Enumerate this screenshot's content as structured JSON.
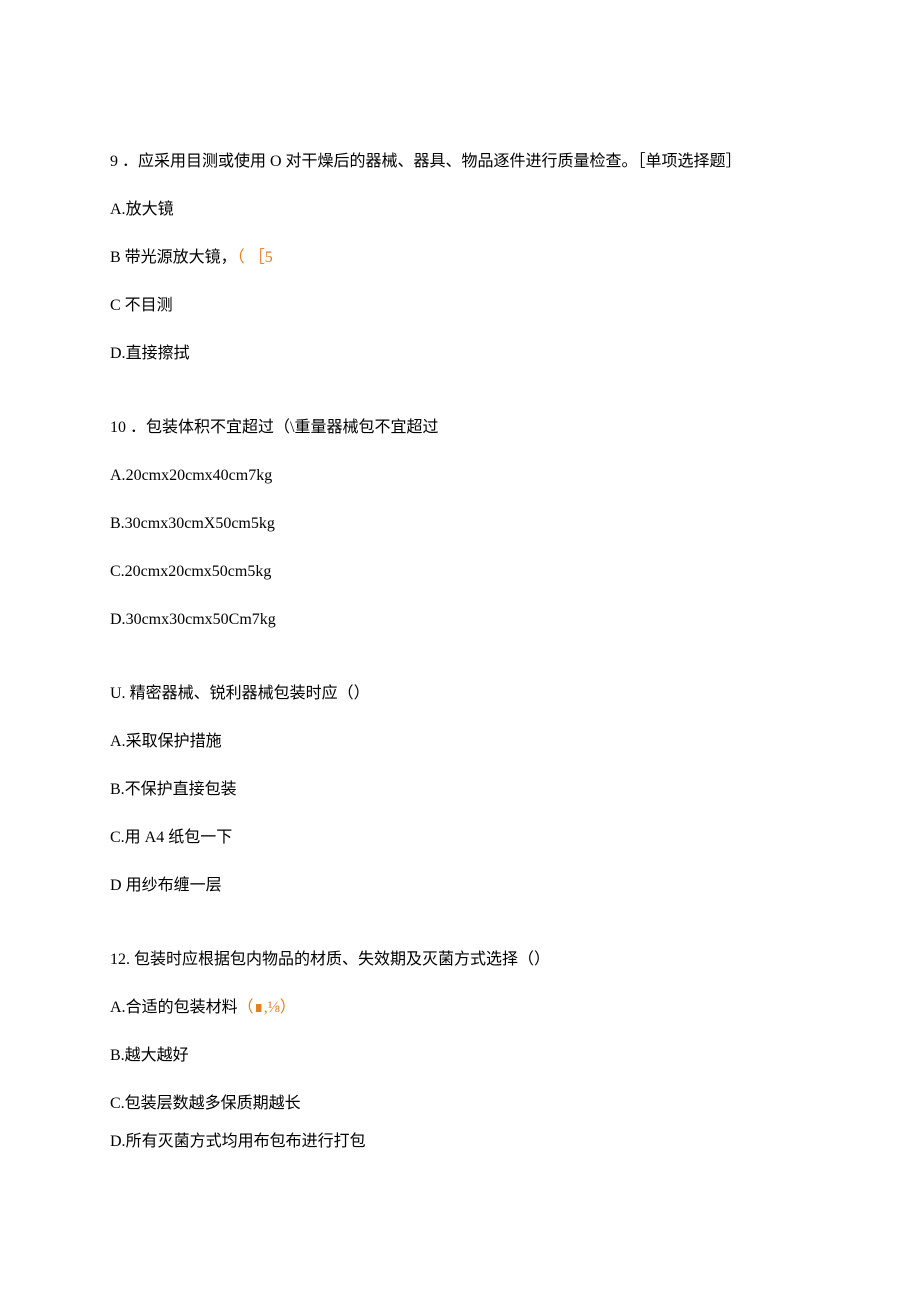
{
  "questions": [
    {
      "num": "9",
      "text": "．应采用目测或使用 O 对干燥后的器械、器具、物品逐件进行质量检查。［单项选择题］",
      "options": [
        {
          "label": "A.",
          "text": "放大镜",
          "suffix": ""
        },
        {
          "label": "B ",
          "text": "带光源放大镜，",
          "suffix": "（ ［5",
          "suffix_orange": true
        },
        {
          "label": "C ",
          "text": "不目测",
          "suffix": ""
        },
        {
          "label": "D.",
          "text": "直接擦拭",
          "suffix": ""
        }
      ]
    },
    {
      "num": "10",
      "text": "．包装体积不宜超过（\\重量器械包不宜超过",
      "options": [
        {
          "label": "A.",
          "text": "20cmx20cmx40cm7kg",
          "suffix": ""
        },
        {
          "label": "B.",
          "text": "30cmx30cmX50cm5kg",
          "suffix": ""
        },
        {
          "label": "C.",
          "text": "20cmx20cmx50cm5kg",
          "suffix": ""
        },
        {
          "label": "D.",
          "text": "30cmx30cmx50Cm7kg",
          "suffix": ""
        }
      ]
    },
    {
      "num": "U.",
      "text": " 精密器械、锐利器械包装时应（）",
      "options": [
        {
          "label": "A.",
          "text": "采取保护措施",
          "suffix": ""
        },
        {
          "label": "B.",
          "text": "不保护直接包装",
          "suffix": ""
        },
        {
          "label": "C.",
          "text": "用 A4 纸包一下",
          "suffix": ""
        },
        {
          "label": "D ",
          "text": "用纱布缠一层",
          "suffix": ""
        }
      ]
    },
    {
      "num": "12.",
      "text": " 包装时应根据包内物品的材质、失效期及灭菌方式选择（）",
      "options": [
        {
          "label": "A.",
          "text": "合适的包装材料",
          "suffix": "（∎,⅛）",
          "suffix_orange": true
        },
        {
          "label": "B.",
          "text": "越大越好",
          "suffix": ""
        },
        {
          "label": "C.",
          "text": "包装层数越多保质期越长",
          "suffix": ""
        },
        {
          "label": "D.",
          "text": "所有灭菌方式均用布包布进行打包",
          "suffix": ""
        }
      ]
    }
  ]
}
